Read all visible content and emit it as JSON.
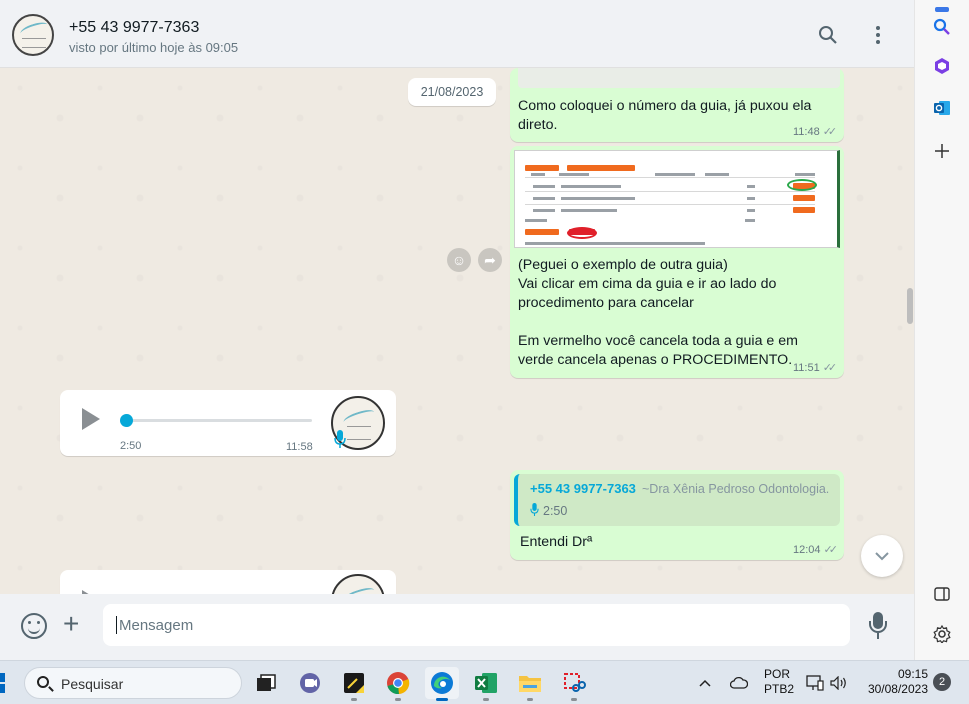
{
  "header": {
    "contact_name": "+55 43 9977-7363",
    "contact_status": "visto por último hoje às 09:05"
  },
  "chat": {
    "date_chip": "21/08/2023",
    "messages": [
      {
        "direction": "outgoing",
        "text": "Como coloquei o número da guia, já puxou ela direto.",
        "time": "11:48"
      },
      {
        "direction": "outgoing",
        "type": "image",
        "text": "(Peguei o exemplo de outra guia)\nVai clicar em cima da guia e ir ao lado do procedimento para cancelar\n\nEm vermelho você cancela toda a guia e em verde cancela apenas o PROCEDIMENTO.",
        "time": "11:51"
      },
      {
        "direction": "incoming",
        "type": "audio",
        "duration": "2:50",
        "time": "11:58",
        "progress": 0
      },
      {
        "direction": "outgoing",
        "quote": {
          "phone": "+55 43 9977-7363",
          "name": "~Dra Xênia Pedroso Odontologia.",
          "audio_duration": "2:50"
        },
        "text": "Entendi Drª",
        "time": "12:04"
      },
      {
        "direction": "incoming",
        "type": "audio"
      }
    ]
  },
  "compose": {
    "placeholder": "Mensagem"
  },
  "taskbar": {
    "search_label": "Pesquisar",
    "lang_top": "POR",
    "lang_bottom": "PTB2",
    "clock_time": "09:15",
    "clock_date": "30/08/2023",
    "notification_count": "2"
  },
  "colors": {
    "outgoing_bubble": "#d9fdd3",
    "incoming_bubble": "#ffffff",
    "accent": "#06a8d8",
    "chat_background": "#efeae2"
  }
}
